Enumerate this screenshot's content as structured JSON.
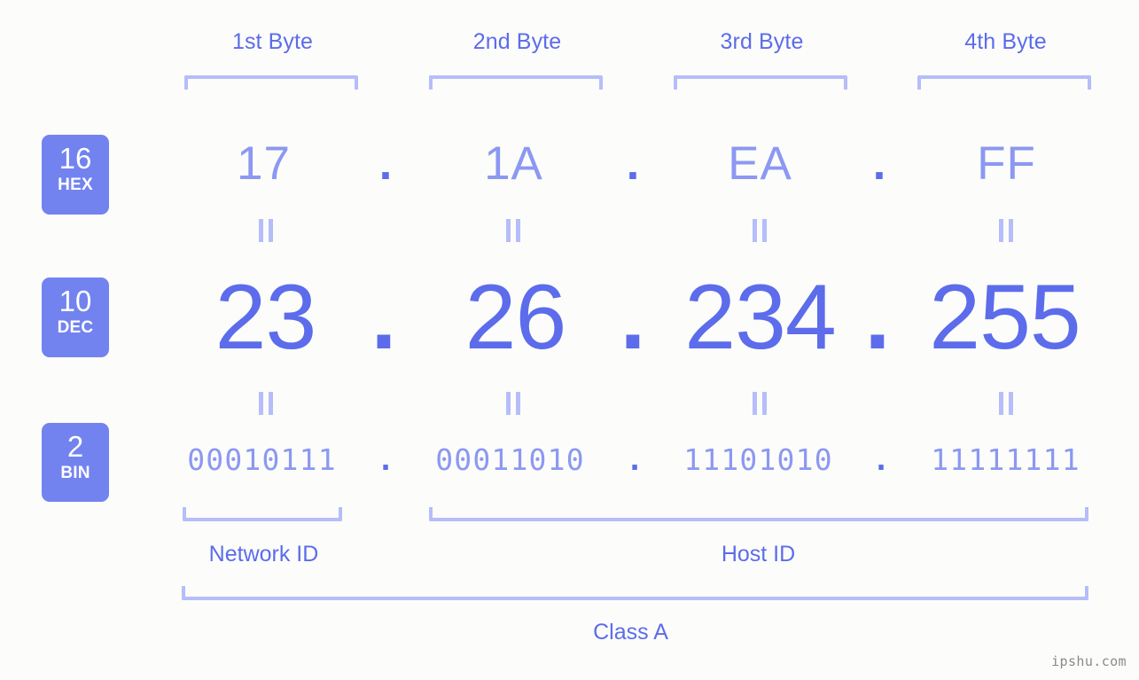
{
  "background_color": "#fcfdfa",
  "accent_color": "#5c6ceb",
  "accent_light_color": "#8c98f2",
  "bracket_color": "#b6bdfa",
  "badge_color": "#7283ef",
  "header": {
    "bytes": [
      {
        "label": "1st Byte"
      },
      {
        "label": "2nd Byte"
      },
      {
        "label": "3rd Byte"
      },
      {
        "label": "4th Byte"
      }
    ]
  },
  "rows": [
    {
      "radix_number": "16",
      "radix_name": "HEX",
      "values": [
        "17",
        "1A",
        "EA",
        "FF"
      ],
      "separator": "."
    },
    {
      "radix_number": "10",
      "radix_name": "DEC",
      "values": [
        "23",
        "26",
        "234",
        "255"
      ],
      "separator": "."
    },
    {
      "radix_number": "2",
      "radix_name": "BIN",
      "values": [
        "00010111",
        "00011010",
        "11101010",
        "11111111"
      ],
      "separator": "."
    }
  ],
  "footer": {
    "network_id_label": "Network ID",
    "host_id_label": "Host ID",
    "class_label": "Class A"
  },
  "watermark": "ipshu.com"
}
